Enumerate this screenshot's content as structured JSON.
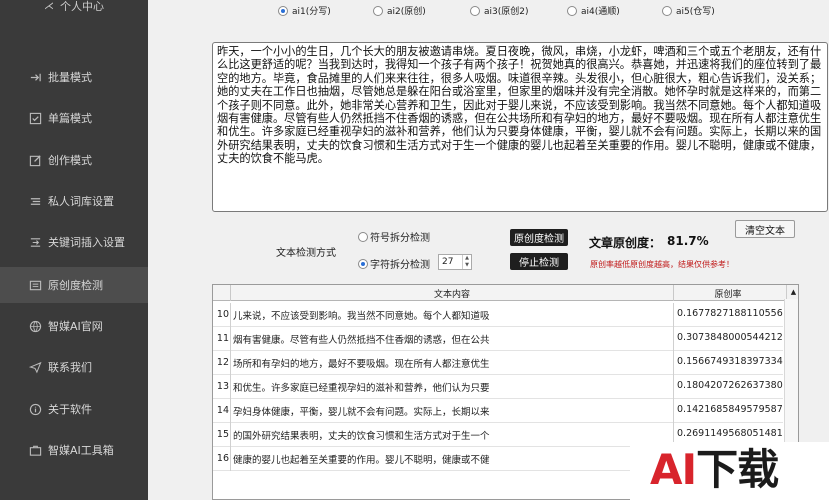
{
  "sidebar": {
    "top_label": "个人中心",
    "items": [
      {
        "label": "批量模式",
        "icon": "batch-arrow-icon"
      },
      {
        "label": "单篇模式",
        "icon": "checkbox-icon"
      },
      {
        "label": "创作模式",
        "icon": "edit-icon"
      },
      {
        "label": "私人词库设置",
        "icon": "list-icon"
      },
      {
        "label": "关键词插入设置",
        "icon": "insert-icon"
      },
      {
        "label": "原创度检测",
        "icon": "document-icon"
      },
      {
        "label": "智媒AI官网",
        "icon": "globe-icon"
      },
      {
        "label": "联系我们",
        "icon": "send-icon"
      },
      {
        "label": "关于软件",
        "icon": "info-icon"
      },
      {
        "label": "智媒AI工具箱",
        "icon": "toolbox-icon"
      }
    ]
  },
  "ai_options": [
    {
      "label": "ai1(分写)",
      "selected": true
    },
    {
      "label": "ai2(原创)",
      "selected": false
    },
    {
      "label": "ai3(原创2)",
      "selected": false
    },
    {
      "label": "ai4(通顺)",
      "selected": false
    },
    {
      "label": "ai5(仓写)",
      "selected": false
    }
  ],
  "article_text": "昨天，一个小小的生日，几个长大的朋友被邀请串烧。夏日夜晚，微风，串烧，小龙虾，啤酒和三个或五个老朋友，还有什么比这更舒适的呢？当我到达时，我得知一个孩子有两个孩子！祝贺她真的很高兴。恭喜她，并迅速将我们的座位转到了最空的地方。毕竟，食品摊里的人们来来往往，很多人吸烟。味道很辛辣。头发很小，但心脏很大，粗心告诉我们，没关系；她的丈夫在工作日也抽烟，尽管她总是躲在阳台或浴室里，但家里的烟味并没有完全消散。她怀孕时就是这样来的，而第二个孩子则不同意。此外，她非常关心营养和卫生，因此对于婴儿来说，不应该受到影响。我当然不同意她。每个人都知道吸烟有害健康。尽管有些人仍然抵挡不住香烟的诱惑，但在公共场所和有孕妇的地方，最好不要吸烟。现在所有人都注意优生和优生。许多家庭已经重视孕妇的滋补和营养，他们认为只要身体健康，平衡，婴儿就不会有问题。实际上，长期以来的国外研究结果表明，丈夫的饮食习惯和生活方式对于生一个健康的婴儿也起着至关重要的作用。婴儿不聪明，健康或不健康，丈夫的饮食不能马虎。",
  "detect": {
    "method_label": "文本检测方式",
    "option_symbol": "符号拆分检测",
    "option_char": "字符拆分检测",
    "char_count": "27",
    "btn_detect": "原创度检测",
    "btn_stop": "停止检测",
    "btn_clear": "清空文本",
    "score_label": "文章原创度：",
    "score_value": "81.7%",
    "warning": "原创率越低原创度越高，结果仅供参考！"
  },
  "table": {
    "col_content": "文本内容",
    "col_rate": "原创率",
    "rows": [
      {
        "idx": "10",
        "text": "儿来说，不应该受到影响。我当然不同意她。每个人都知道吸",
        "rate": "0.16778271881105566"
      },
      {
        "idx": "11",
        "text": "烟有害健康。尽管有些人仍然抵挡不住香烟的诱惑，但在公共",
        "rate": "0.30738480005442126"
      },
      {
        "idx": "12",
        "text": "场所和有孕妇的地方，最好不要吸烟。现在所有人都注意优生",
        "rate": "0.15667493183973344"
      },
      {
        "idx": "13",
        "text": "和优生。许多家庭已经重视孕妇的滋补和营养，他们认为只要",
        "rate": "0.18042072626373806"
      },
      {
        "idx": "14",
        "text": "孕妇身体健康，平衡，婴儿就不会有问题。实际上，长期以来",
        "rate": "0.14216858495795873"
      },
      {
        "idx": "15",
        "text": "的国外研究结果表明，丈夫的饮食习惯和生活方式对于生一个",
        "rate": "0.26911495680514813"
      },
      {
        "idx": "16",
        "text": "健康的婴儿也起着至关重要的作用。婴儿不聪明，健康或不健",
        "rate": ""
      }
    ]
  },
  "watermark": {
    "ai": "AI",
    "cn": "下载"
  }
}
